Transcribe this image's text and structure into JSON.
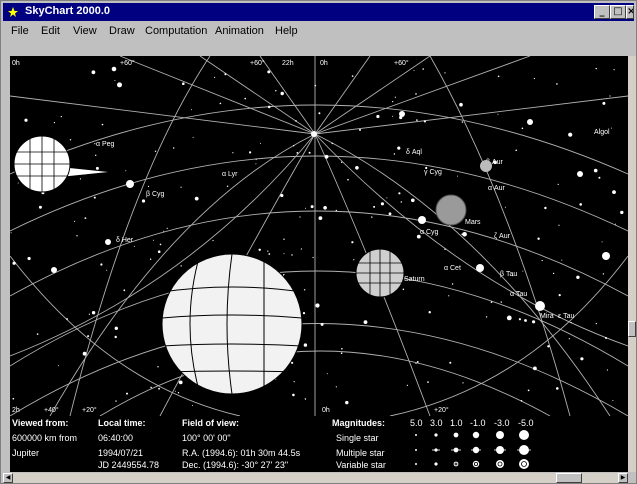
{
  "window": {
    "title": "SkyChart 2000.0",
    "buttons": {
      "minimize": "_",
      "maximize": "□",
      "close": "×"
    }
  },
  "menu": [
    {
      "label": "File"
    },
    {
      "label": "Edit"
    },
    {
      "label": "View"
    },
    {
      "label": "Draw"
    },
    {
      "label": "Computation"
    },
    {
      "label": "Animation"
    },
    {
      "label": "Help"
    }
  ],
  "chart": {
    "grid_labels_top": [
      "0h",
      "+60°",
      "+60°",
      "22h",
      "0h",
      "+60°"
    ],
    "grid_labels_bottom": [
      "2h",
      "+40°",
      "+20°",
      "0h",
      "+20°"
    ],
    "star_labels": [
      "α Peg",
      "β Cyg",
      "α Lyr",
      "δ Her",
      "δ Aql",
      "γ Cyg",
      "α Cyg",
      "β Aur",
      "α Aur",
      "ζ Aur",
      "β Tau",
      "Mira",
      "α Cet",
      "α Tau",
      "ε Tau",
      "Algol",
      "Saturn",
      "Jupiter",
      "Mars"
    ],
    "colors": {
      "background": "#000000",
      "grid": "#b0b0b0",
      "stars": "#ffffff",
      "jupiter": "#f2f2f2",
      "saturn": "#cfcfcf",
      "mars": "#9a9a9a"
    }
  },
  "info": {
    "viewed_from_label": "Viewed from:",
    "viewed_from_distance": "600000 km from",
    "viewed_from_body": "Jupiter",
    "local_time_label": "Local time:",
    "local_time": "06:40:00",
    "local_date": "1994/07/21",
    "julian_day": "JD 2449554.78",
    "field_label": "Field of view:",
    "field_value": "100° 00' 00\"",
    "ra": "R.A. (1994.6): 01h 30m 44.5s",
    "dec": "Dec. (1994.6): -30° 27' 23\"",
    "magnitudes_label": "Magnitudes:",
    "magnitude_values": [
      "5.0",
      "3.0",
      "1.0",
      "-1.0",
      "-3.0",
      "-5.0"
    ],
    "legend_single": "Single star",
    "legend_multiple": "Multiple star",
    "legend_variable": "Variable star"
  }
}
